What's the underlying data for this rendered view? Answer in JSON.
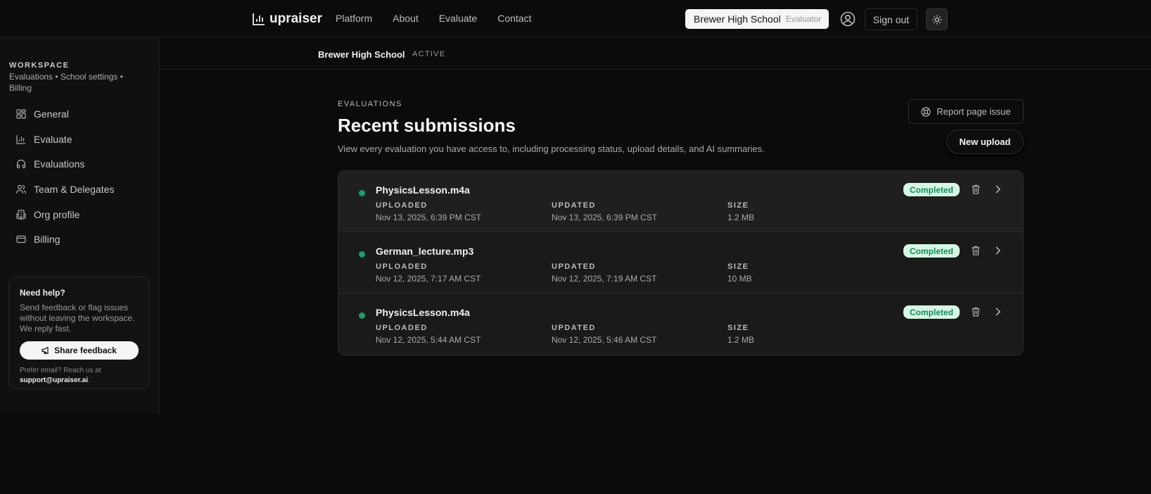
{
  "header": {
    "logo": "upraiser",
    "nav": [
      "Platform",
      "About",
      "Evaluate",
      "Contact"
    ],
    "org": "Brewer High School",
    "role": "Evaluator",
    "sign_out": "Sign out"
  },
  "subheader": {
    "org": "Brewer High School",
    "status": "ACTIVE"
  },
  "sidebar": {
    "title": "WORKSPACE",
    "subtitle": "Evaluations • School settings • Billing",
    "items": [
      {
        "label": "General",
        "icon": "grid-icon"
      },
      {
        "label": "Evaluate",
        "icon": "bar-chart-icon"
      },
      {
        "label": "Evaluations",
        "icon": "headphones-icon"
      },
      {
        "label": "Team & Delegates",
        "icon": "users-icon"
      },
      {
        "label": "Org profile",
        "icon": "building-icon"
      },
      {
        "label": "Billing",
        "icon": "credit-card-icon"
      }
    ],
    "help": {
      "title": "Need help?",
      "text": "Send feedback or flag issues without leaving the workspace. We reply fast.",
      "button": "Share feedback",
      "email_prefix": "Prefer email? Reach us at",
      "email": "support@upraiser.ai",
      "email_suffix": "."
    }
  },
  "main": {
    "eyebrow": "EVALUATIONS",
    "title": "Recent submissions",
    "description": "View every evaluation you have access to, including processing status, upload details, and AI summaries.",
    "report": "Report page issue",
    "new_upload": "New upload",
    "labels": {
      "uploaded": "UPLOADED",
      "updated": "UPDATED",
      "size": "SIZE"
    },
    "rows": [
      {
        "name": "PhysicsLesson.m4a",
        "uploaded": "Nov 13, 2025, 6:39 PM CST",
        "updated": "Nov 13, 2025, 6:39 PM CST",
        "size": "1.2 MB",
        "status": "Completed"
      },
      {
        "name": "German_lecture.mp3",
        "uploaded": "Nov 12, 2025, 7:17 AM CST",
        "updated": "Nov 12, 2025, 7:19 AM CST",
        "size": "10 MB",
        "status": "Completed"
      },
      {
        "name": "PhysicsLesson.m4a",
        "uploaded": "Nov 12, 2025, 5:44 AM CST",
        "updated": "Nov 12, 2025, 5:46 AM CST",
        "size": "1.2 MB",
        "status": "Completed"
      }
    ]
  },
  "colors": {
    "status_green": "#1d9c6a",
    "badge_bg": "#d5f7e4"
  }
}
